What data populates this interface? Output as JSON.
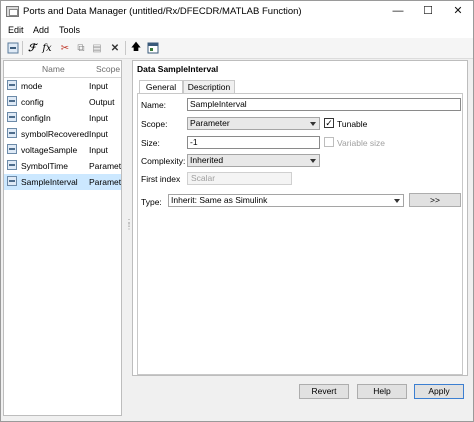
{
  "window": {
    "title": "Ports and Data Manager (untitled/Rx/DFECDR/MATLAB Function)",
    "minimize": "—",
    "maximize": "☐",
    "close": "✕"
  },
  "menu": [
    "Edit",
    "Add",
    "Tools"
  ],
  "toolbar_icons": [
    "add-data-icon",
    "add-function-icon",
    "fx-icon",
    "cut-icon",
    "copy-icon",
    "paste-icon",
    "delete-icon",
    "up-arrow-icon",
    "model-explorer-icon"
  ],
  "left_pane": {
    "headers": {
      "name": "Name",
      "scope": "Scope"
    },
    "rows": [
      {
        "name": "mode",
        "scope": "Input"
      },
      {
        "name": "config",
        "scope": "Output"
      },
      {
        "name": "configIn",
        "scope": "Input"
      },
      {
        "name": "symbolRecovered",
        "scope": "Input"
      },
      {
        "name": "voltageSample",
        "scope": "Input"
      },
      {
        "name": "SymbolTime",
        "scope": "Parameter"
      },
      {
        "name": "SampleInterval",
        "scope": "Parameter"
      }
    ],
    "selected_index": 6
  },
  "right_pane": {
    "title": "Data SampleInterval",
    "tabs": [
      "General",
      "Description"
    ],
    "active_tab": "General",
    "name_label": "Name:",
    "name_value": "SampleInterval",
    "scope_label": "Scope:",
    "scope_value": "Parameter",
    "tunable_label": "Tunable",
    "tunable_checked": true,
    "size_label": "Size:",
    "size_value": "-1",
    "variable_size_label": "Variable size",
    "variable_size_checked": false,
    "complexity_label": "Complexity:",
    "complexity_value": "Inherited",
    "first_index_label": "First index",
    "first_index_value": "Scalar",
    "type_label": "Type:",
    "type_value": "Inherit: Same as Simulink",
    "type_button": ">>"
  },
  "buttons": {
    "revert": "Revert",
    "help": "Help",
    "apply": "Apply"
  }
}
